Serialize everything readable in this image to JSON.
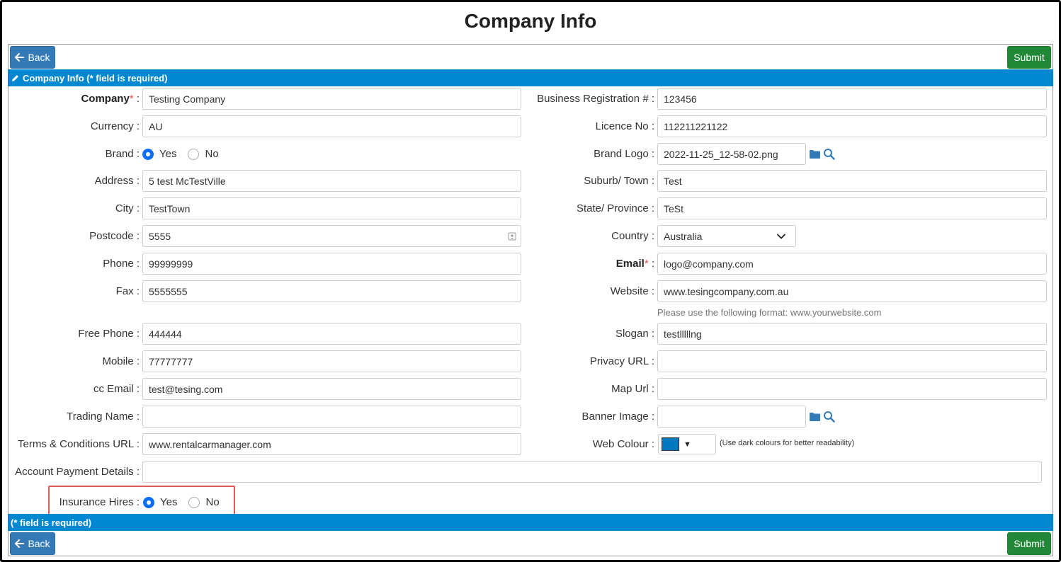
{
  "page": {
    "title": "Company Info"
  },
  "buttons": {
    "back": "Back",
    "submit": "Submit"
  },
  "section": {
    "header": "Company Info (* field is required)",
    "footer": "(* field is required)"
  },
  "left": {
    "company": {
      "label": "Company",
      "value": "Testing Company"
    },
    "currency": {
      "label": "Currency :",
      "value": "AU"
    },
    "brand": {
      "label": "Brand :",
      "yes": "Yes",
      "no": "No",
      "selected": "Yes"
    },
    "address": {
      "label": "Address :",
      "value": "5 test McTestVille"
    },
    "city": {
      "label": "City :",
      "value": "TestTown"
    },
    "postcode": {
      "label": "Postcode :",
      "value": "5555"
    },
    "phone": {
      "label": "Phone :",
      "value": "99999999"
    },
    "fax": {
      "label": "Fax :",
      "value": "5555555"
    },
    "free_phone": {
      "label": "Free Phone :",
      "value": "444444"
    },
    "mobile": {
      "label": "Mobile :",
      "value": "77777777"
    },
    "cc_email": {
      "label": "cc Email :",
      "value": "test@tesing.com"
    },
    "trading_name": {
      "label": "Trading Name :",
      "value": ""
    },
    "terms_url": {
      "label": "Terms & Conditions URL :",
      "value": "www.rentalcarmanager.com"
    },
    "account_payment": {
      "label": "Account Payment Details :",
      "value": ""
    },
    "insurance_hires": {
      "label": "Insurance Hires :",
      "yes": "Yes",
      "no": "No",
      "selected": "Yes"
    }
  },
  "right": {
    "business_reg": {
      "label": "Business Registration # :",
      "value": "123456"
    },
    "licence_no": {
      "label": "Licence No :",
      "value": "112211221122"
    },
    "brand_logo": {
      "label": "Brand Logo :",
      "value": "2022-11-25_12-58-02.png"
    },
    "suburb": {
      "label": "Suburb/ Town :",
      "value": "Test"
    },
    "state": {
      "label": "State/ Province :",
      "value": "TeSt"
    },
    "country": {
      "label": "Country :",
      "value": "Australia"
    },
    "email": {
      "label": "Email",
      "value": "logo@company.com"
    },
    "website": {
      "label": "Website :",
      "value": "www.tesingcompany.com.au",
      "help": "Please use the following format: www.yourwebsite.com"
    },
    "slogan": {
      "label": "Slogan :",
      "value": "testlllllng"
    },
    "privacy_url": {
      "label": "Privacy URL :",
      "value": ""
    },
    "map_url": {
      "label": "Map Url :",
      "value": ""
    },
    "banner_image": {
      "label": "Banner Image :",
      "value": ""
    },
    "web_colour": {
      "label": "Web Colour :",
      "color": "#0277bd",
      "help": "(Use dark colours for better readability)"
    }
  },
  "colors": {
    "primary": "#337ab7",
    "success": "#218838",
    "bar": "#0288d1",
    "radio": "#0d6efd",
    "icon": "#337ab7",
    "highlight": "#e05a5a"
  },
  "icons": {
    "back": "arrow-left-icon",
    "edit": "pencil-icon",
    "folder": "folder-icon",
    "search": "search-icon",
    "contact": "contact-card-icon",
    "dropdown": "chevron-down-icon"
  }
}
